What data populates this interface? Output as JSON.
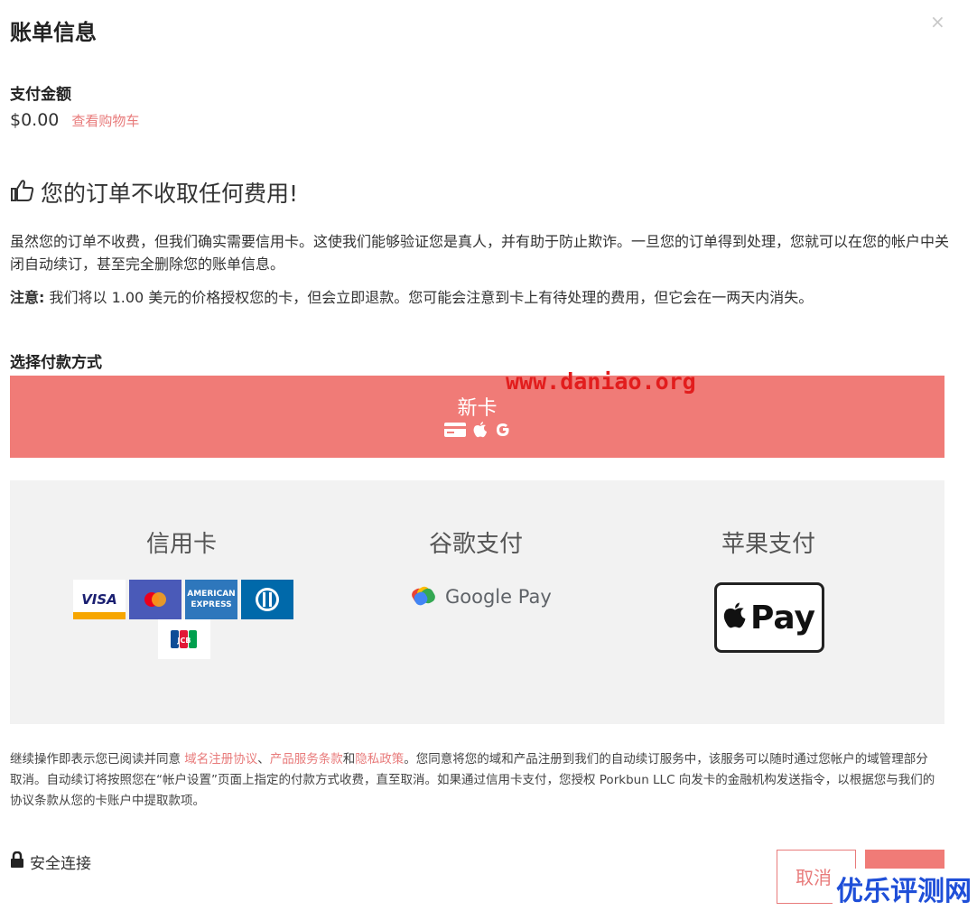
{
  "modal": {
    "title": "账单信息",
    "close_label": "×"
  },
  "amount": {
    "label": "支付金额",
    "value": "$0.00",
    "cart_link": "查看购物车"
  },
  "free_notice": {
    "heading": "您的订单不收取任何费用!",
    "paragraph": "虽然您的订单不收费，但我们确实需要信用卡。这使我们能够验证您是真人，并有助于防止欺诈。一旦您的订单得到处理，您就可以在您的帐户中关闭自动续订，甚至完全删除您的账单信息。",
    "note_label": "注意:",
    "note_text": " 我们将以 1.00 美元的价格授权您的卡，但会立即退款。您可能会注意到卡上有待处理的费用，但它会在一两天内消失。"
  },
  "payment": {
    "label": "选择付款方式",
    "new_card_label": "新卡",
    "watermark": "www.daniao.org",
    "methods": [
      {
        "title": "信用卡"
      },
      {
        "title": "谷歌支付",
        "logo_text": "Google Pay"
      },
      {
        "title": "苹果支付",
        "logo_text": "Pay"
      }
    ],
    "cards": [
      "VISA",
      "Mastercard",
      "AMERICAN EXPRESS",
      "Diners Club",
      "JCB"
    ]
  },
  "terms": {
    "part1": "继续操作即表示您已阅读并同意 ",
    "link1": "域名注册协议",
    "sep1": "、",
    "link2": "产品服务条款",
    "sep2": "和",
    "link3": "隐私政策",
    "part2": "。您同意将您的域和产品注册到我们的自动续订服务中，该服务可以随时通过您帐户的域管理部分取消。自动续订将按照您在“帐户设置”页面上指定的付款方式收费，直至取消。如果通过信用卡支付，您授权 Porkbun LLC 向发卡的金融机构发送指令，以根据您与我们的协议条款从您的卡账户中提取款项。"
  },
  "footer": {
    "secure_label": "安全连接",
    "cancel_label": "取消",
    "brand_watermark": "优乐评测网"
  },
  "colors": {
    "accent": "#f07b77",
    "link": "#e87b7b",
    "panel_bg": "#f2f2f2"
  }
}
